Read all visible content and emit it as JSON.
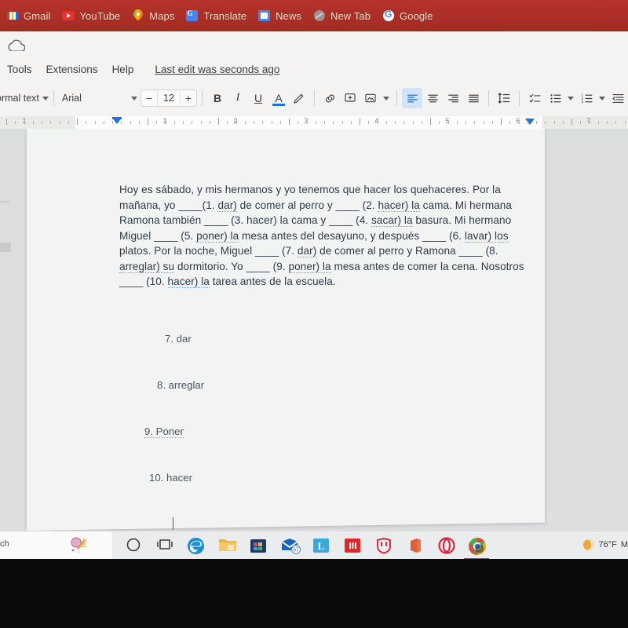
{
  "browser": {
    "bookmarks": [
      {
        "label": "Gmail",
        "icon": "gmail-icon"
      },
      {
        "label": "YouTube",
        "icon": "youtube-icon"
      },
      {
        "label": "Maps",
        "icon": "maps-icon"
      },
      {
        "label": "Translate",
        "icon": "translate-icon"
      },
      {
        "label": "News",
        "icon": "news-icon"
      },
      {
        "label": "New Tab",
        "icon": "new-tab-icon"
      },
      {
        "label": "Google",
        "icon": "google-icon"
      }
    ],
    "bookmark_bar_color": "#ad2f27"
  },
  "docs": {
    "cloud_icon": "cloud-saved-icon",
    "menus": [
      {
        "label": "Tools"
      },
      {
        "label": "Extensions"
      },
      {
        "label": "Help"
      }
    ],
    "last_edit": "Last edit was seconds ago",
    "toolbar": {
      "style": "Normal text",
      "font": "Arial",
      "font_size": "12",
      "decrease_label": "−",
      "increase_label": "+",
      "bold_label": "B",
      "italic_label": "I",
      "underline_label": "U",
      "text_color_label": "A",
      "highlight_icon": "highlight-pen-icon",
      "link_icon": "insert-link-icon",
      "comment_icon": "add-comment-icon",
      "image_icon": "insert-image-icon",
      "align_left_icon": "align-left-icon",
      "align_center_icon": "align-center-icon",
      "align_right_icon": "align-right-icon",
      "align_justify_icon": "align-justify-icon",
      "line_spacing_icon": "line-spacing-icon",
      "checklist_icon": "checklist-icon",
      "bulleted_list_icon": "bulleted-list-icon",
      "numbered_list_icon": "numbered-list-icon",
      "decrease_indent_icon": "decrease-indent-icon",
      "active_alignment": "align-left",
      "active_color": "#d2e3fc"
    },
    "ruler": {
      "numbers": [
        "1",
        "1",
        "2",
        "3",
        "4",
        "5",
        "6",
        "7"
      ],
      "left_indent_marker": "left-indent-marker",
      "right_indent_marker": "right-indent-marker"
    }
  },
  "document": {
    "paragraph_parts": [
      {
        "t": "Hoy es sábado, y mis hermanos y yo tenemos que hacer los quehaceres. Por la mañana, yo "
      },
      {
        "t": "____",
        "blank": true
      },
      {
        "t": "(1. "
      },
      {
        "t": "dar)",
        "sq": true
      },
      {
        "t": " de comer al perro y "
      },
      {
        "t": "____",
        "blank": true
      },
      {
        "t": " (2. "
      },
      {
        "t": "hacer) la",
        "sq": true
      },
      {
        "t": " cama. Mi hermana Ramona también "
      },
      {
        "t": "____",
        "blank": true
      },
      {
        "t": " (3. hacer) la cama y "
      },
      {
        "t": "____",
        "blank": true
      },
      {
        "t": " (4. "
      },
      {
        "t": "sacar) la",
        "sq": true
      },
      {
        "t": " basura. Mi hermano Miguel "
      },
      {
        "t": "____",
        "blank": true
      },
      {
        "t": " (5. "
      },
      {
        "t": "poner) la",
        "sq": true
      },
      {
        "t": " mesa antes del desayuno, y después "
      },
      {
        "t": "____",
        "blank": true
      },
      {
        "t": " (6. "
      },
      {
        "t": "lavar) los",
        "sq": true
      },
      {
        "t": " platos. Por la noche, Miguel "
      },
      {
        "t": "____",
        "blank": true
      },
      {
        "t": " (7. "
      },
      {
        "t": "dar)",
        "sq": true
      },
      {
        "t": " de comer al perro y Ramona "
      },
      {
        "t": "____",
        "blank": true
      },
      {
        "t": " (8. "
      },
      {
        "t": "arreglar) su",
        "sq": true
      },
      {
        "t": " dormitorio. Yo "
      },
      {
        "t": "____",
        "blank": true
      },
      {
        "t": " (9. "
      },
      {
        "t": "poner) la",
        "sq": true
      },
      {
        "t": " mesa antes de comer la cena. Nosotros "
      },
      {
        "t": "____",
        "blank": true
      },
      {
        "t": " (10. "
      },
      {
        "t": "hacer) la",
        "sq": true
      },
      {
        "t": " tarea antes de la escuela."
      }
    ],
    "paragraph_plain": "Hoy es sábado, y mis hermanos y yo tenemos que hacer los quehaceres. Por la mañana, yo ____(1. dar) de comer al perro y ____ (2. hacer) la cama. Mi hermana Ramona también ____ (3. hacer) la cama y ____ (4. sacar) la basura. Mi hermano Miguel ____ (5. poner) la mesa antes del desayuno, y después ____ (6. lavar) los platos. Por la noche, Miguel ____ (7. dar) de comer al perro y Ramona ____ (8. arreglar) su dormitorio. Yo ____ (9. poner) la mesa antes de comer la cena. Nosotros ____ (10. hacer) la tarea antes de la escuela.",
    "answers": [
      {
        "id": "ans7",
        "text": "7. dar"
      },
      {
        "id": "ans8",
        "text": "8. arreglar"
      },
      {
        "id": "ans9",
        "text": "9. Poner"
      },
      {
        "id": "ans10",
        "text": "10. hacer"
      }
    ]
  },
  "taskbar": {
    "search_text": "ch",
    "items": [
      {
        "name": "paint-3d-icon"
      },
      {
        "name": "cortana-circle-icon"
      },
      {
        "name": "task-view-icon"
      },
      {
        "name": "edge-icon"
      },
      {
        "name": "file-explorer-icon"
      },
      {
        "name": "store-icon"
      },
      {
        "name": "mail-icon",
        "badge": "57"
      },
      {
        "name": "lastpass-icon",
        "label": "L"
      },
      {
        "name": "red-app-icon"
      },
      {
        "name": "shield-app-icon"
      },
      {
        "name": "office-icon"
      },
      {
        "name": "opera-icon"
      },
      {
        "name": "chrome-icon",
        "active": true
      }
    ],
    "weather": {
      "temperature": "76°F",
      "condition": "M",
      "icon": "moon-icon"
    }
  }
}
